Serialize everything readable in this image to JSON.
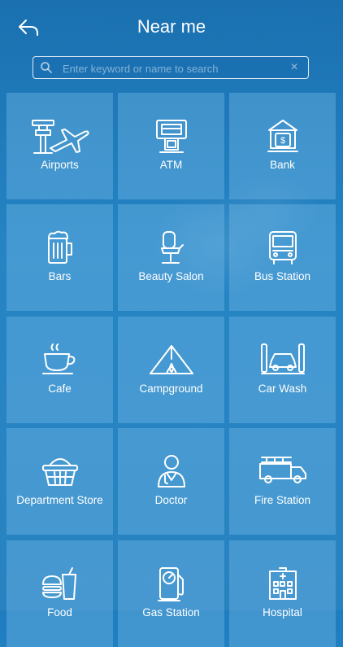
{
  "header": {
    "title": "Near me",
    "back_icon": "back-arrow-icon"
  },
  "search": {
    "placeholder": "Enter keyword or name to search",
    "value": "",
    "clear_label": "×"
  },
  "categories": [
    {
      "label": "Airports",
      "icon": "airport-icon"
    },
    {
      "label": "ATM",
      "icon": "atm-icon"
    },
    {
      "label": "Bank",
      "icon": "bank-icon"
    },
    {
      "label": "Bars",
      "icon": "beer-mug-icon"
    },
    {
      "label": "Beauty Salon",
      "icon": "salon-chair-icon"
    },
    {
      "label": "Bus Station",
      "icon": "bus-icon"
    },
    {
      "label": "Cafe",
      "icon": "coffee-cup-icon"
    },
    {
      "label": "Campground",
      "icon": "tent-icon"
    },
    {
      "label": "Car Wash",
      "icon": "car-wash-icon"
    },
    {
      "label": "Department Store",
      "icon": "basket-icon"
    },
    {
      "label": "Doctor",
      "icon": "doctor-icon"
    },
    {
      "label": "Fire Station",
      "icon": "fire-truck-icon"
    },
    {
      "label": "Food",
      "icon": "fast-food-icon"
    },
    {
      "label": "Gas Station",
      "icon": "gas-pump-icon"
    },
    {
      "label": "Hospital",
      "icon": "hospital-icon"
    }
  ]
}
